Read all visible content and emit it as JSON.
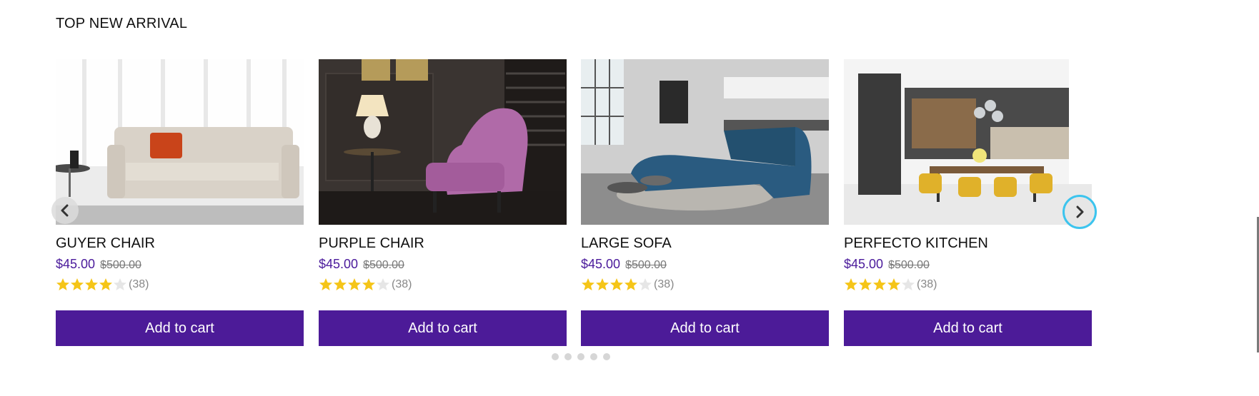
{
  "section": {
    "title": "TOP NEW ARRIVAL"
  },
  "products": [
    {
      "name": "GUYER CHAIR",
      "price": "$45.00",
      "old_price": "$500.00",
      "rating": 4,
      "rating_count": "(38)",
      "cta": "Add to cart",
      "image": "sofa-living-room"
    },
    {
      "name": "PURPLE CHAIR",
      "price": "$45.00",
      "old_price": "$500.00",
      "rating": 4,
      "rating_count": "(38)",
      "cta": "Add to cart",
      "image": "purple-chair-room"
    },
    {
      "name": "LARGE SOFA",
      "price": "$45.00",
      "old_price": "$500.00",
      "rating": 4,
      "rating_count": "(38)",
      "cta": "Add to cart",
      "image": "blue-sectional-sofa"
    },
    {
      "name": "PERFECTO KITCHEN",
      "price": "$45.00",
      "old_price": "$500.00",
      "rating": 4,
      "rating_count": "(38)",
      "cta": "Add to cart",
      "image": "kitchen-dining"
    }
  ],
  "carousel": {
    "pages": 5,
    "active_page": 1
  },
  "colors": {
    "accent": "#4c1b98",
    "price": "#4a1a9b",
    "star": "#f5c518",
    "star_empty": "#e6e6e6",
    "focus_ring": "#3cc4ee"
  },
  "icons": {
    "prev": "chevron-left-icon",
    "next": "chevron-right-icon",
    "star": "star-icon"
  }
}
